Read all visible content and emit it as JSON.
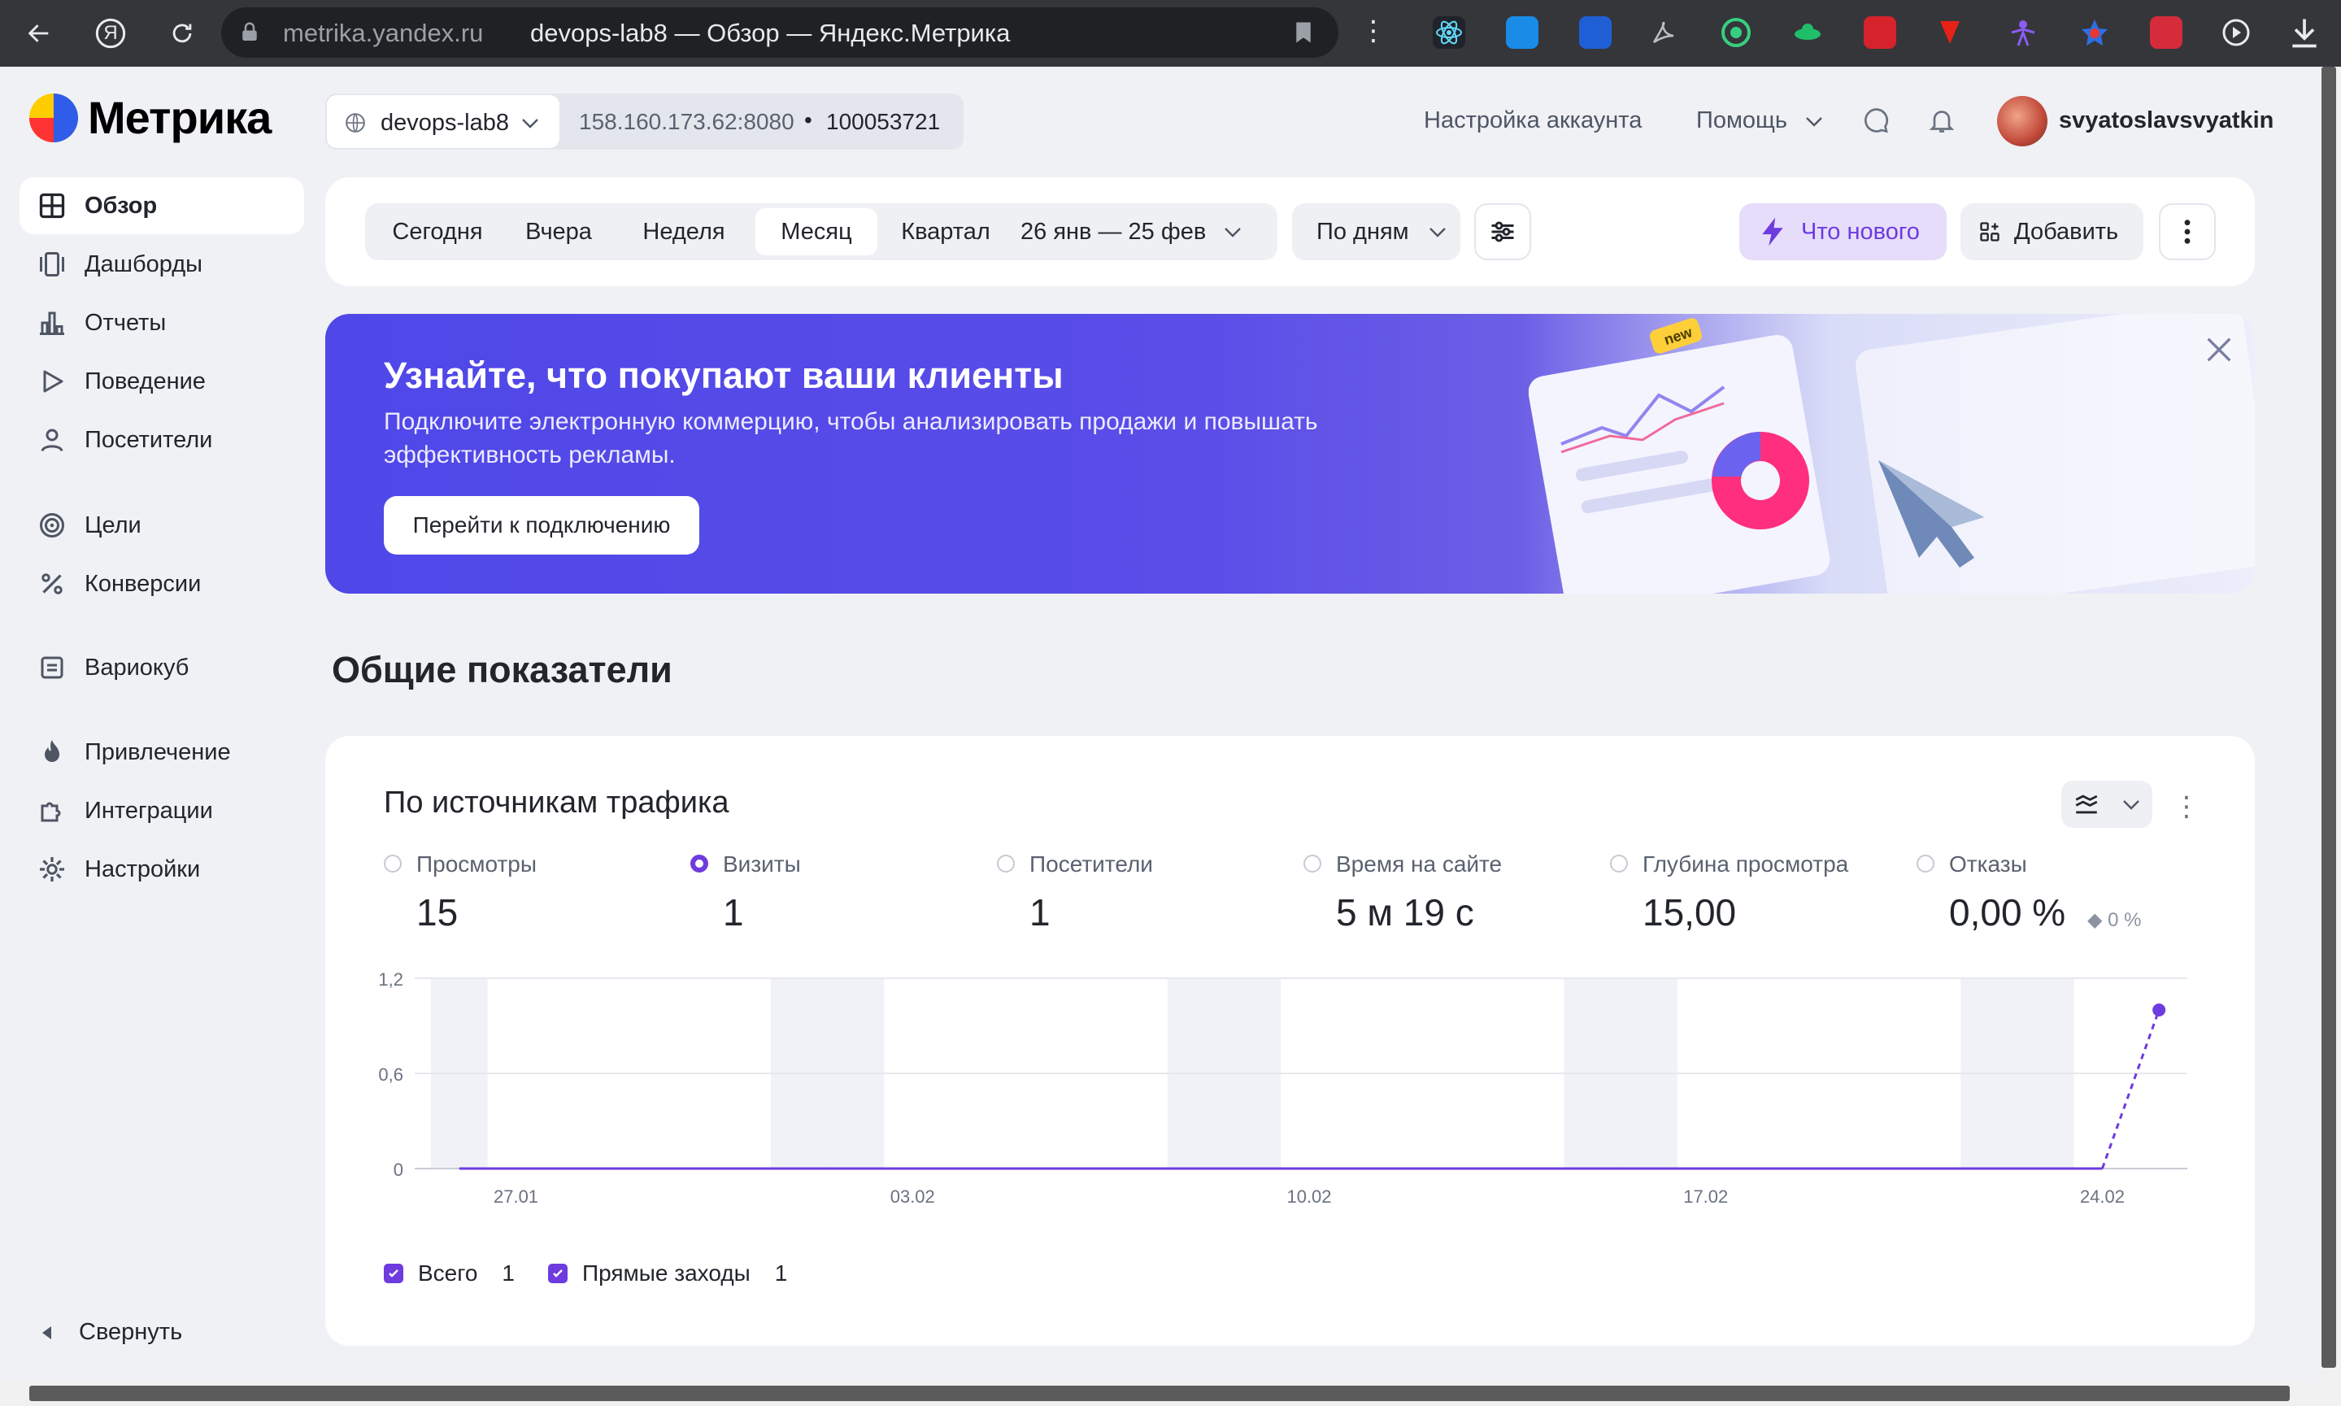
{
  "browser": {
    "domain": "metrika.yandex.ru",
    "page_title": "devops-lab8 — Обзор — Яндекс.Метрика",
    "yandex_button": "Я"
  },
  "header": {
    "logo_text": "Метрика",
    "counter_name": "devops-lab8",
    "counter_url": "158.160.173.62:8080",
    "separator": "•",
    "counter_id": "100053721",
    "account_settings": "Настройка аккаунта",
    "help": "Помощь",
    "username": "svyatoslavsvyatkin"
  },
  "sidebar": {
    "items": [
      {
        "label": "Обзор",
        "icon": "grid-icon"
      },
      {
        "label": "Дашборды",
        "icon": "dashboard-icon"
      },
      {
        "label": "Отчеты",
        "icon": "bar-chart-icon"
      },
      {
        "label": "Поведение",
        "icon": "play-icon"
      },
      {
        "label": "Посетители",
        "icon": "person-icon"
      },
      {
        "label": "Цели",
        "icon": "target-icon"
      },
      {
        "label": "Конверсии",
        "icon": "percent-icon"
      },
      {
        "label": "Вариокуб",
        "icon": "cube-icon"
      },
      {
        "label": "Привлечение",
        "icon": "flame-icon"
      },
      {
        "label": "Интеграции",
        "icon": "puzzle-icon"
      },
      {
        "label": "Настройки",
        "icon": "gear-icon"
      }
    ],
    "collapse_label": "Свернуть"
  },
  "toolbar": {
    "periods": [
      "Сегодня",
      "Вчера",
      "Неделя",
      "Месяц",
      "Квартал"
    ],
    "selected_period": "Месяц",
    "date_range": "26 янв — 25 фев",
    "grouping": "По дням",
    "whats_new": "Что нового",
    "add": "Добавить"
  },
  "banner": {
    "title": "Узнайте, что покупают ваши клиенты",
    "subtitle": "Подключите электронную коммерцию, чтобы анализировать продажи и повышать эффективность рекламы.",
    "cta": "Перейти к подключению",
    "badge": "new"
  },
  "section_title": "Общие показатели",
  "widget": {
    "title": "По источникам трафика",
    "metrics": [
      {
        "label": "Просмотры",
        "value": "15",
        "selected": false
      },
      {
        "label": "Визиты",
        "value": "1",
        "selected": true
      },
      {
        "label": "Посетители",
        "value": "1",
        "selected": false
      },
      {
        "label": "Время на сайте",
        "value": "5 м 19 с",
        "selected": false
      },
      {
        "label": "Глубина просмотра",
        "value": "15,00",
        "selected": false
      },
      {
        "label": "Отказы",
        "value": "0,00 %",
        "delta": "◆ 0 %",
        "selected": false
      }
    ],
    "legend": [
      {
        "label": "Всего",
        "count": "1"
      },
      {
        "label": "Прямые заходы",
        "count": "1"
      }
    ]
  },
  "chart_data": {
    "type": "line",
    "x": [
      "26.01",
      "27.01",
      "28.01",
      "29.01",
      "30.01",
      "31.01",
      "01.02",
      "02.02",
      "03.02",
      "04.02",
      "05.02",
      "06.02",
      "07.02",
      "08.02",
      "09.02",
      "10.02",
      "11.02",
      "12.02",
      "13.02",
      "14.02",
      "15.02",
      "16.02",
      "17.02",
      "18.02",
      "19.02",
      "20.02",
      "21.02",
      "22.02",
      "23.02",
      "24.02",
      "25.02"
    ],
    "x_tick_labels": [
      "27.01",
      "03.02",
      "10.02",
      "17.02",
      "24.02"
    ],
    "series": [
      {
        "values": [
          0,
          0,
          0,
          0,
          0,
          0,
          0,
          0,
          0,
          0,
          0,
          0,
          0,
          0,
          0,
          0,
          0,
          0,
          0,
          0,
          0,
          0,
          0,
          0,
          0,
          0,
          0,
          0,
          0,
          0,
          1
        ],
        "color": "#6e3bde"
      }
    ],
    "y_ticks": [
      "0",
      "0,6",
      "1,2"
    ],
    "ylim": [
      0,
      1.2
    ],
    "weekend_shading": true,
    "grid": true
  },
  "colors": {
    "accent": "#6e3bde",
    "banner": "#4f47e8",
    "background": "#eff1f5"
  }
}
